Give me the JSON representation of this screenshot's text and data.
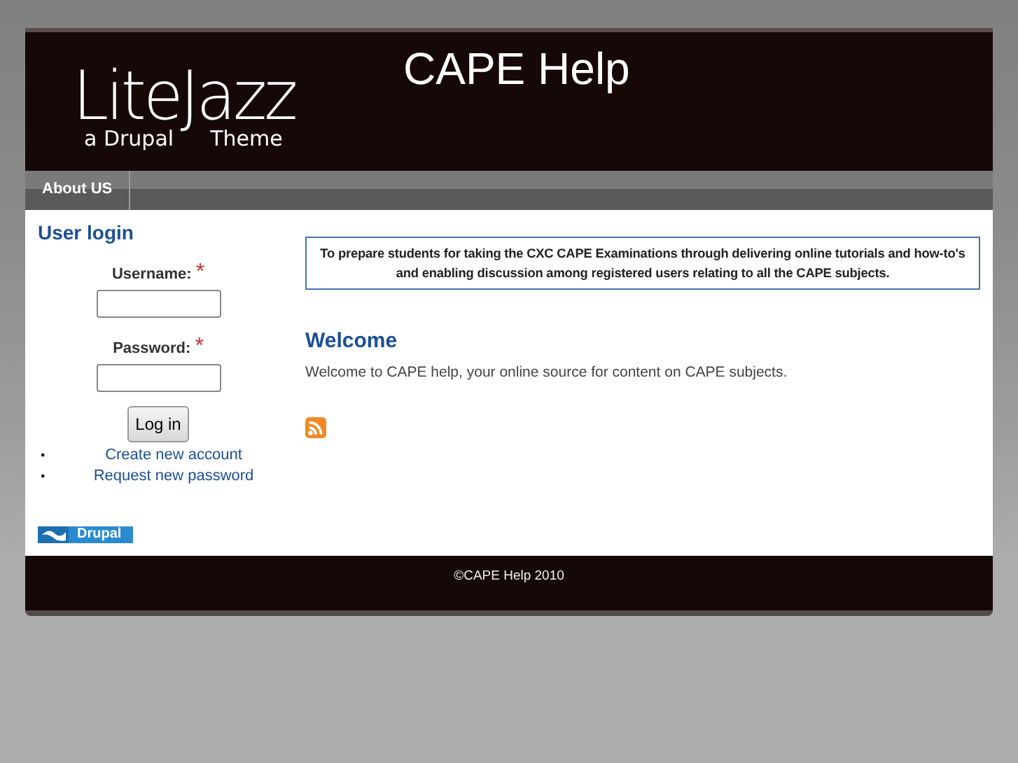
{
  "header": {
    "logo": {
      "name": "LiteJazz",
      "tagline_left": "a Drupal",
      "tagline_right": "Theme"
    },
    "site_name": "CAPE Help"
  },
  "nav": [
    {
      "label": "About US",
      "selected": false
    }
  ],
  "login": {
    "title": "User login",
    "fields": [
      {
        "label": "Username:",
        "required_mark": "*"
      },
      {
        "label": "Password:",
        "required_mark": "*"
      }
    ],
    "button": "Log in",
    "links": [
      {
        "bullet": "•",
        "text": "Create new account"
      },
      {
        "bullet": "•",
        "text": "Request new password"
      }
    ]
  },
  "powered_by": "Drupal",
  "mission": "To prepare students for taking the CXC CAPE Examinations through delivering online tutorials and how-to's and enabling discussion among registered users relating to all the CAPE subjects.",
  "welcome": {
    "title": "Welcome",
    "text": "Welcome to CAPE help, your online source for content on CAPE subjects."
  },
  "footer": "©CAPE Help 2010"
}
